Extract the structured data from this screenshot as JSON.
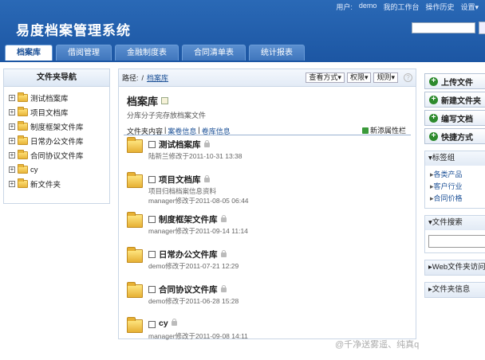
{
  "header": {
    "logo": "易度档案管理系统",
    "top_links": {
      "user_label": "用户:",
      "user_name": "demo",
      "workbench": "我的工作台",
      "history": "操作历史",
      "settings": "设置▾"
    }
  },
  "tabs": [
    {
      "label": "档案库",
      "active": true
    },
    {
      "label": "借阅管理"
    },
    {
      "label": "金融制度表"
    },
    {
      "label": "合同清单表"
    },
    {
      "label": "统计报表"
    }
  ],
  "leftnav": {
    "title": "文件夹导航",
    "items": [
      "测试档案库",
      "项目文档库",
      "制度框架文件库",
      "日常办公文件库",
      "合同协议文件库",
      "cy",
      "新文件夹"
    ]
  },
  "center": {
    "path_label": "路径:",
    "path_link": "档案库",
    "buttons": {
      "view": "查看方式▾",
      "perm": "权限▾",
      "rule": "规则▾",
      "help": "?"
    },
    "title": "档案库",
    "subtitle": "分库分子完存放档案文件",
    "subtabs": {
      "contents": "文件夹内容",
      "sep1": "|",
      "archive_info": "案卷信息",
      "sep2": "|",
      "library_info": "卷库信息"
    },
    "add_prop": "新添属性栏",
    "entries": [
      {
        "name": "测试档案库",
        "meta": "陆新兰修改于2011-10-31 13:38",
        "meta2": ""
      },
      {
        "name": "项目文档库",
        "meta": "项目归档档案信息资料",
        "meta2": "manager修改于2011-08-05 06:44"
      },
      {
        "name": "制度框架文件库",
        "meta": "manager修改于2011-09-14 11:14",
        "meta2": ""
      },
      {
        "name": "日常办公文件库",
        "meta": "demo修改于2011-07-21 12:29",
        "meta2": ""
      },
      {
        "name": "合同协议文件库",
        "meta": "demo修改于2011-06-28 15:28",
        "meta2": ""
      },
      {
        "name": "cy",
        "meta": "manager修改于2011-09-08 14:11",
        "meta2": ""
      }
    ]
  },
  "right": {
    "buttons": [
      "上传文件",
      "新建文件夹",
      "编写文档",
      "快捷方式"
    ],
    "tag_title": "▾标签组",
    "tags": [
      "各类产品",
      "客户行业",
      "合同价格"
    ],
    "search_title": "▾文件搜索",
    "web_title": "▸Web文件夹访问",
    "info_title": "▸文件夹信息"
  },
  "watermark": "@千净送雾遥、纯真q"
}
